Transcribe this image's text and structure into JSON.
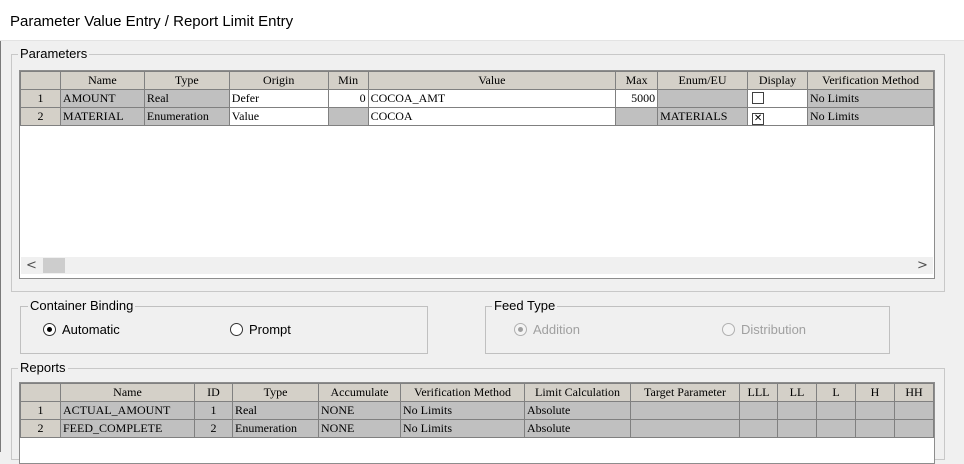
{
  "window": {
    "title": "Parameter Value Entry / Report Limit Entry"
  },
  "parameters": {
    "label": "Parameters",
    "columns": [
      "",
      "Name",
      "Type",
      "Origin",
      "Min",
      "Value",
      "Max",
      "Enum/EU",
      "Display",
      "Verification Method"
    ],
    "rows": [
      {
        "num": "1",
        "name": "AMOUNT",
        "type": "Real",
        "origin": "Defer",
        "min": "0",
        "value": "COCOA_AMT",
        "max": "5000",
        "enum": "",
        "display": false,
        "verification": "No Limits"
      },
      {
        "num": "2",
        "name": "MATERIAL",
        "type": "Enumeration",
        "origin": "Value",
        "min": "",
        "value": "COCOA",
        "max": "",
        "enum": "MATERIALS",
        "display": true,
        "verification": "No Limits"
      }
    ],
    "scroll_left": "<",
    "scroll_right": ">"
  },
  "container_binding": {
    "label": "Container Binding",
    "options": [
      {
        "label": "Automatic",
        "selected": true
      },
      {
        "label": "Prompt",
        "selected": false
      }
    ]
  },
  "feed_type": {
    "label": "Feed Type",
    "disabled": true,
    "options": [
      {
        "label": "Addition",
        "selected": true
      },
      {
        "label": "Distribution",
        "selected": false
      }
    ]
  },
  "reports": {
    "label": "Reports",
    "columns": [
      "",
      "Name",
      "ID",
      "Type",
      "Accumulate",
      "Verification Method",
      "Limit Calculation",
      "Target Parameter",
      "LLL",
      "LL",
      "L",
      "H",
      "HH"
    ],
    "rows": [
      {
        "num": "1",
        "name": "ACTUAL_AMOUNT",
        "id": "1",
        "type": "Real",
        "accumulate": "NONE",
        "verification": "No Limits",
        "limit_calc": "Absolute",
        "target": "",
        "lll": "",
        "ll": "",
        "l": "",
        "h": "",
        "hh": ""
      },
      {
        "num": "2",
        "name": "FEED_COMPLETE",
        "id": "2",
        "type": "Enumeration",
        "accumulate": "NONE",
        "verification": "No Limits",
        "limit_calc": "Absolute",
        "target": "",
        "lll": "",
        "ll": "",
        "l": "",
        "h": "",
        "hh": ""
      }
    ]
  }
}
